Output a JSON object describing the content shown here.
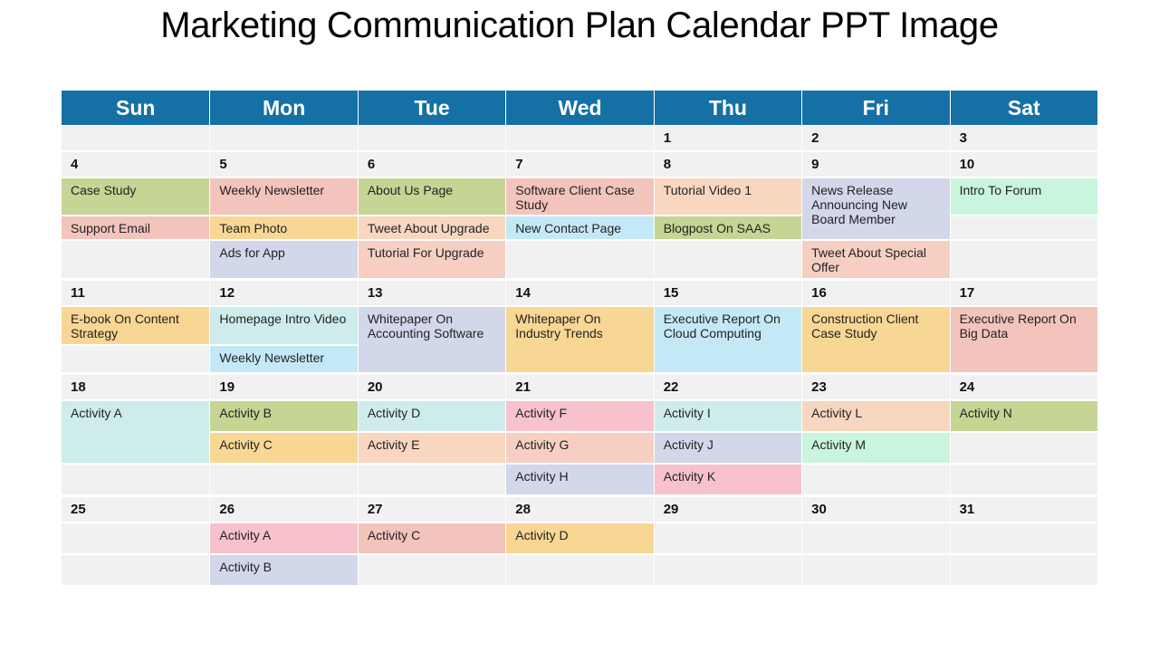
{
  "title": "Marketing Communication Plan Calendar PPT Image",
  "colors": {
    "header": "#1570a6",
    "cell_bg": "#f1f1f1",
    "green": "#c6d494",
    "pink": "#f3c4bc",
    "salmon": "#f6cfc2",
    "orange": "#f8d694",
    "lavender": "#d2d7ea",
    "skyblue": "#c4e9f6",
    "mint": "#c8f5dc",
    "aqua": "#ceecec",
    "peach": "#f8d6c0",
    "rose": "#f7c2cc"
  },
  "days": [
    "Sun",
    "Mon",
    "Tue",
    "Wed",
    "Thu",
    "Fri",
    "Sat"
  ],
  "weeks": [
    [
      "",
      "",
      "",
      "",
      "1",
      "2",
      "3"
    ],
    [
      "4",
      "5",
      "6",
      "7",
      "8",
      "9",
      "10"
    ],
    [
      "11",
      "12",
      "13",
      "14",
      "15",
      "16",
      "17"
    ],
    [
      "18",
      "19",
      "20",
      "21",
      "22",
      "23",
      "24"
    ],
    [
      "25",
      "26",
      "27",
      "28",
      "29",
      "30",
      "31"
    ]
  ],
  "events": [
    {
      "date": "4",
      "label": "Case Study",
      "color": "green"
    },
    {
      "date": "4",
      "label": "Support Email",
      "color": "pink"
    },
    {
      "date": "5",
      "label": "Weekly Newsletter",
      "color": "pink"
    },
    {
      "date": "5",
      "label": "Team Photo",
      "color": "orange"
    },
    {
      "date": "5",
      "label": "Ads for App",
      "color": "lavender"
    },
    {
      "date": "6",
      "label": "About Us Page",
      "color": "green"
    },
    {
      "date": "6",
      "label": "Tweet About Upgrade",
      "color": "peach"
    },
    {
      "date": "6",
      "label": "Tutorial For Upgrade",
      "color": "salmon"
    },
    {
      "date": "7",
      "label": "Software Client Case Study",
      "color": "pink"
    },
    {
      "date": "7",
      "label": "New Contact Page",
      "color": "skyblue"
    },
    {
      "date": "8",
      "label": "Tutorial Video 1",
      "color": "peach"
    },
    {
      "date": "8",
      "label": "Blogpost On SAAS",
      "color": "green"
    },
    {
      "date": "9",
      "label": "News Release Announcing New Board Member",
      "color": "lavender"
    },
    {
      "date": "9",
      "label": "Tweet About Special Offer",
      "color": "salmon"
    },
    {
      "date": "10",
      "label": "Intro To Forum",
      "color": "mint"
    },
    {
      "date": "11",
      "label": "E-book On Content Strategy",
      "color": "orange"
    },
    {
      "date": "12",
      "label": "Homepage Intro Video",
      "color": "aqua"
    },
    {
      "date": "12",
      "label": "Weekly Newsletter",
      "color": "skyblue"
    },
    {
      "date": "13",
      "label": "Whitepaper On Accounting Software",
      "color": "lavender"
    },
    {
      "date": "14",
      "label": "Whitepaper On Industry Trends",
      "color": "orange"
    },
    {
      "date": "15",
      "label": "Executive Report On Cloud Computing",
      "color": "skyblue"
    },
    {
      "date": "16",
      "label": "Construction Client Case Study",
      "color": "orange"
    },
    {
      "date": "17",
      "label": "Executive Report On Big Data",
      "color": "pink"
    },
    {
      "date": "18",
      "label": "Activity A",
      "color": "aqua"
    },
    {
      "date": "19",
      "label": "Activity B",
      "color": "green"
    },
    {
      "date": "19",
      "label": "Activity C",
      "color": "orange"
    },
    {
      "date": "20",
      "label": "Activity D",
      "color": "aqua"
    },
    {
      "date": "20",
      "label": "Activity E",
      "color": "peach"
    },
    {
      "date": "21",
      "label": "Activity F",
      "color": "rose"
    },
    {
      "date": "21",
      "label": "Activity G",
      "color": "salmon"
    },
    {
      "date": "21",
      "label": "Activity H",
      "color": "lavender"
    },
    {
      "date": "22",
      "label": "Activity I",
      "color": "aqua"
    },
    {
      "date": "22",
      "label": "Activity J",
      "color": "lavender"
    },
    {
      "date": "22",
      "label": "Activity K",
      "color": "rose"
    },
    {
      "date": "23",
      "label": "Activity L",
      "color": "peach"
    },
    {
      "date": "23",
      "label": "Activity M",
      "color": "mint"
    },
    {
      "date": "24",
      "label": "Activity N",
      "color": "green"
    },
    {
      "date": "26",
      "label": "Activity A",
      "color": "rose"
    },
    {
      "date": "26",
      "label": "Activity B",
      "color": "lavender"
    },
    {
      "date": "27",
      "label": "Activity C",
      "color": "pink"
    },
    {
      "date": "28",
      "label": "Activity D",
      "color": "orange"
    }
  ]
}
